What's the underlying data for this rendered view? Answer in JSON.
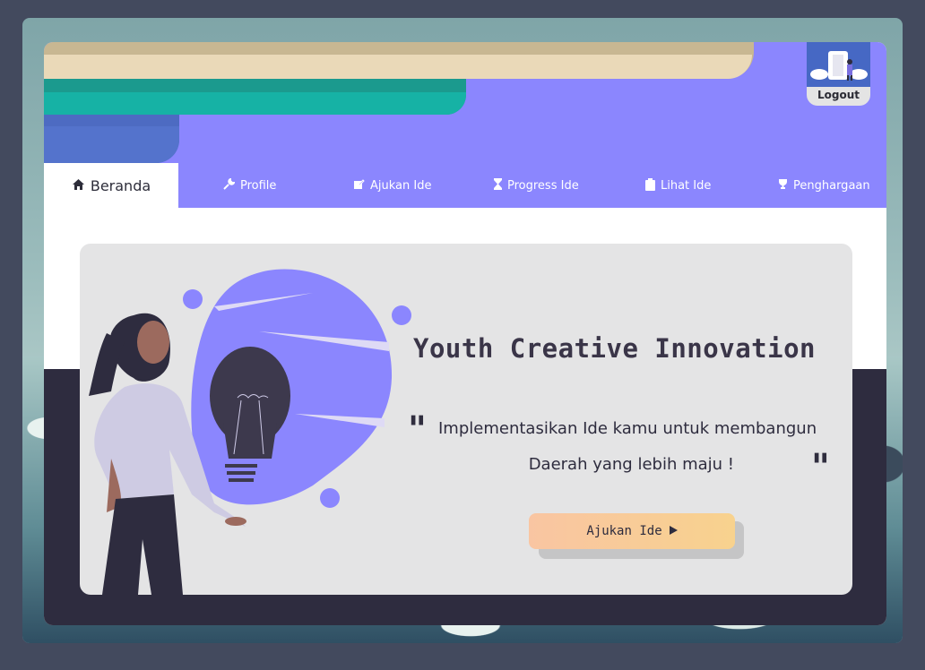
{
  "logout": {
    "label": "Logout"
  },
  "nav": {
    "items": [
      {
        "label": "Beranda",
        "icon": "home-icon"
      },
      {
        "label": "Profile",
        "icon": "wrench-icon"
      },
      {
        "label": "Ajukan Ide",
        "icon": "edit-icon"
      },
      {
        "label": "Progress Ide",
        "icon": "hourglass-icon"
      },
      {
        "label": "Lihat Ide",
        "icon": "clipboard-icon"
      },
      {
        "label": "Penghargaan",
        "icon": "trophy-icon"
      }
    ]
  },
  "hero": {
    "title": "Youth Creative Innovation",
    "line1": "Implementasikan Ide kamu untuk membangun",
    "line2": "Daerah yang lebih maju !",
    "cta_label": "Ajukan Ide",
    "cta_icon": "play-icon"
  },
  "colors": {
    "accent_purple": "#8b86fe",
    "dark_navy": "#2e2c3f",
    "card_gray": "#e4e4e5",
    "cta_gradient_start": "#f9c5a2",
    "cta_gradient_end": "#f8d28e"
  }
}
